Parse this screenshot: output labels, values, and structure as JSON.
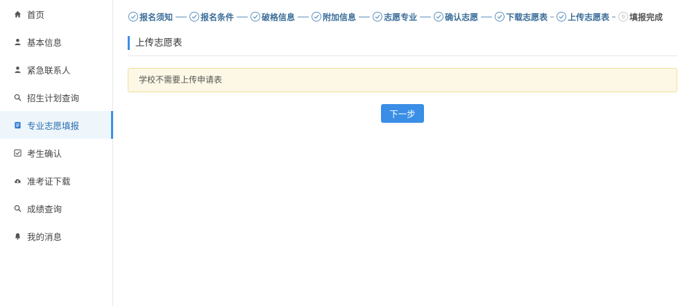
{
  "sidebar": {
    "items": [
      {
        "label": "首页",
        "icon": "home-icon"
      },
      {
        "label": "基本信息",
        "icon": "user-icon"
      },
      {
        "label": "紧急联系人",
        "icon": "user-icon"
      },
      {
        "label": "招生计划查询",
        "icon": "search-icon"
      },
      {
        "label": "专业志愿填报",
        "icon": "document-icon",
        "active": true
      },
      {
        "label": "考生确认",
        "icon": "checkbox-icon"
      },
      {
        "label": "准考证下载",
        "icon": "cloud-download-icon"
      },
      {
        "label": "成绩查询",
        "icon": "search-icon"
      },
      {
        "label": "我的消息",
        "icon": "bell-icon"
      }
    ]
  },
  "steps": [
    {
      "label": "报名须知",
      "status": "done"
    },
    {
      "label": "报名条件",
      "status": "done"
    },
    {
      "label": "破格信息",
      "status": "done"
    },
    {
      "label": "附加信息",
      "status": "done"
    },
    {
      "label": "志愿专业",
      "status": "done"
    },
    {
      "label": "确认志愿",
      "status": "done"
    },
    {
      "label": "下载志愿表",
      "status": "done"
    },
    {
      "label": "上传志愿表",
      "status": "done"
    },
    {
      "label": "填报完成",
      "status": "pending",
      "number": "9"
    }
  ],
  "main": {
    "section_title": "上传志愿表",
    "notice": "学校不需要上传申请表",
    "next_button": "下一步"
  },
  "colors": {
    "accent": "#3a8ee6",
    "step_text": "#3d6e99",
    "notice_bg": "#fdf8e5",
    "notice_border": "#f3dc9c"
  }
}
